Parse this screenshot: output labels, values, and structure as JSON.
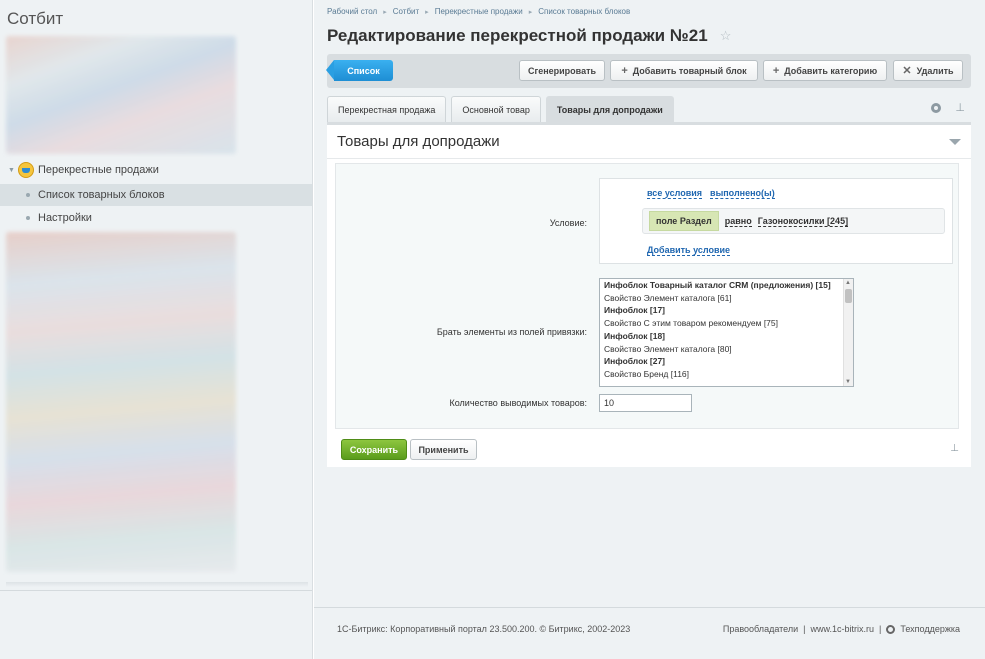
{
  "sidebar": {
    "title": "Сотбит",
    "items": [
      {
        "label": "Перекрестные продажи",
        "icon": "shopping-cart-icon"
      },
      {
        "label": "Список товарных блоков"
      },
      {
        "label": "Настройки"
      }
    ]
  },
  "breadcrumb": [
    "Рабочий стол",
    "Сотбит",
    "Перекрестные продажи",
    "Список товарных блоков"
  ],
  "page": {
    "title": "Редактирование перекрестной продажи №21"
  },
  "toolbar": {
    "list_label": "Список",
    "generate_label": "Сгенерировать",
    "add_block_label": "Добавить товарный блок",
    "add_category_label": "Добавить категорию",
    "delete_label": "Удалить"
  },
  "tabs": [
    {
      "label": "Перекрестная продажа"
    },
    {
      "label": "Основной товар"
    },
    {
      "label": "Товары для допродажи",
      "active": true
    }
  ],
  "panel": {
    "title": "Товары для допродажи",
    "condition": {
      "label": "Условие:",
      "all_conditions": "все условия",
      "fulfilled": "выполнено(ы)",
      "field": "поле Раздел",
      "operator": "равно",
      "value": "Газонокосилки [245]",
      "add_condition": "Добавить условие"
    },
    "binding": {
      "label": "Брать элементы из полей привязки:",
      "options": [
        {
          "text": "Инфоблок Товарный каталог CRM (предложения) [15]",
          "group": true
        },
        {
          "text": "Свойство Элемент каталога [61]",
          "group": false
        },
        {
          "text": "Инфоблок [17]",
          "group": true
        },
        {
          "text": "Свойство С этим товаром рекомендуем [75]",
          "group": false
        },
        {
          "text": "Инфоблок [18]",
          "group": true
        },
        {
          "text": "Свойство Элемент каталога [80]",
          "group": false
        },
        {
          "text": "Инфоблок [27]",
          "group": true
        },
        {
          "text": "Свойство Бренд [116]",
          "group": false
        }
      ]
    },
    "quantity": {
      "label": "Количество выводимых товаров:",
      "value": "10"
    },
    "save_label": "Сохранить",
    "apply_label": "Применить"
  },
  "footer": {
    "copyright": "1С-Битрикс: Корпоративный портал 23.500.200. © Битрикс, 2002-2023",
    "rights": "Правообладатели",
    "site": "www.1c-bitrix.ru",
    "support": "Техподдержка"
  },
  "colors": {
    "accent": "#1e8ed4",
    "save": "#5a9c1c",
    "link": "#2067b0"
  }
}
